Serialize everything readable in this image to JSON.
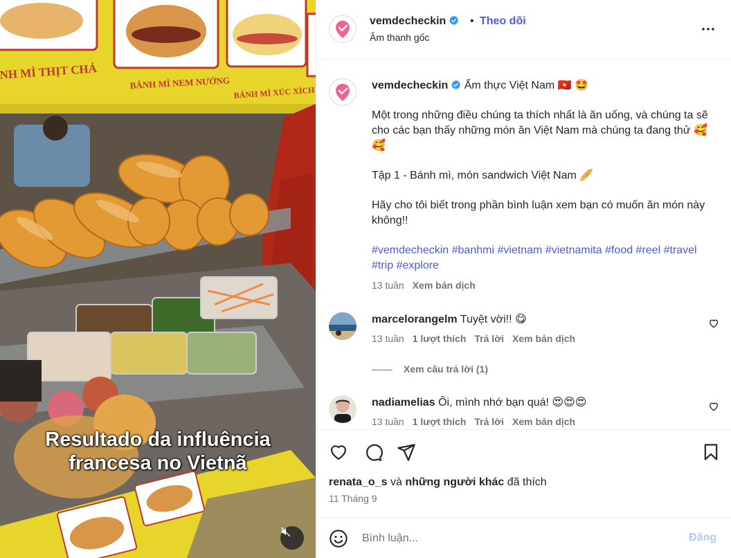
{
  "media": {
    "overlay_line1": "Resultado da influência",
    "overlay_line2": "francesa no Vietnã",
    "signs": [
      "BÁNH MÌ THỊT CHẢ",
      "BÁNH MÌ NEM NƯỚNG",
      "BÁNH MÌ XÚC XÍCH"
    ],
    "mute_icon": "volume-muted-icon"
  },
  "header": {
    "username": "vemdecheckin",
    "separator": "•",
    "follow_label": "Theo dõi",
    "audio": "Âm thanh gốc",
    "more_icon": "more-horizontal-icon"
  },
  "caption": {
    "username": "vemdecheckin",
    "title": "Ẩm thực Việt Nam 🇻🇳 🤩",
    "para1": "Một trong những điều chúng ta thích nhất là ăn uống, và chúng ta sẽ cho các bạn thấy những món ăn Việt Nam mà chúng ta đang thử 🥰🥰",
    "para2": "Tập 1 - Bánh mì, món sandwich Việt Nam 🥖",
    "para3": "Hãy cho tôi biết trong phần bình luận xem bạn có muốn ăn món này không!!",
    "hashtags": "#vemdecheckin #banhmi #vietnam #vietnamita #food #reel #travel #trip #explore",
    "time": "13 tuần",
    "translate": "Xem bản dịch"
  },
  "comments": [
    {
      "username": "marcelorangelm",
      "text": "Tuyệt vời!! 😋",
      "time": "13 tuần",
      "likes": "1 lượt thích",
      "reply": "Trả lời",
      "translate": "Xem bản dịch"
    },
    {
      "username": "nadiamelias",
      "text": "Ôi, mình nhớ bạn quá! 😍😍😍",
      "time": "13 tuần",
      "likes": "1 lượt thích",
      "reply": "Trả lời",
      "translate": "Xem bản dịch"
    }
  ],
  "view_replies": "Xem câu trả lời (1)",
  "actions": {
    "icons": [
      "heart-icon",
      "comment-icon",
      "share-icon",
      "bookmark-icon"
    ],
    "liked_by_user": "renata_o_s",
    "liked_and": "và",
    "liked_others": "những người khác",
    "liked_suffix": "đã thích",
    "date": "11 Tháng 9"
  },
  "comment_box": {
    "placeholder": "Bình luận...",
    "post_label": "Đăng"
  },
  "colors": {
    "link_blue": "#4a5bdc",
    "muted": "#737373",
    "post_disabled": "#b6c9ee",
    "brand_pink": "#f06292"
  }
}
